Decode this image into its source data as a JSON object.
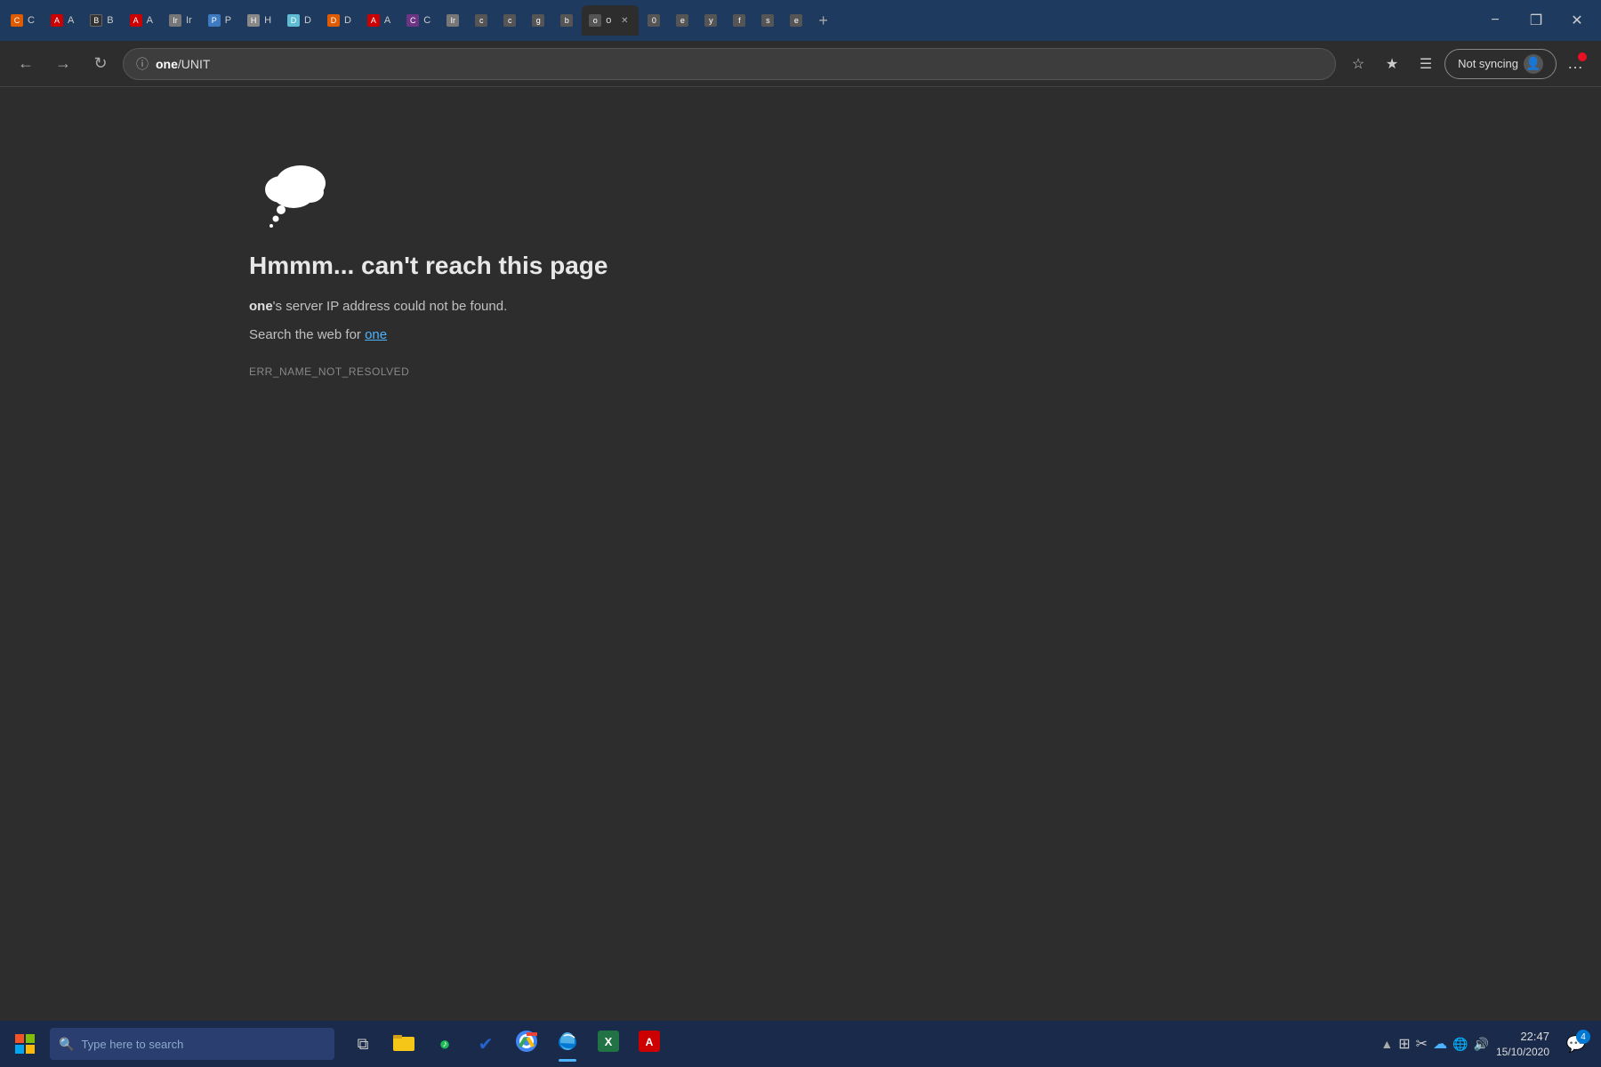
{
  "browser": {
    "title": "Microsoft Edge",
    "colors": {
      "tabbar_bg": "#1e3a5f",
      "toolbar_bg": "#2d2d2d",
      "content_bg": "#2d2d2d",
      "accent": "#0078d4"
    }
  },
  "tabs": [
    {
      "id": 1,
      "label": "C",
      "color": "#e05a00",
      "active": false
    },
    {
      "id": 2,
      "label": "A",
      "color": "#cc0000",
      "active": false
    },
    {
      "id": 3,
      "label": "B",
      "color": "#222",
      "active": false
    },
    {
      "id": 4,
      "label": "A",
      "color": "#cc0000",
      "active": false
    },
    {
      "id": 5,
      "label": "Ir",
      "color": "#555",
      "active": false
    },
    {
      "id": 6,
      "label": "P",
      "color": "#3e7abf",
      "active": false
    },
    {
      "id": 7,
      "label": "H",
      "color": "#555",
      "active": false
    },
    {
      "id": 8,
      "label": "D",
      "color": "#5dbcd2",
      "active": false
    },
    {
      "id": 9,
      "label": "D",
      "color": "#e05a00",
      "active": false
    },
    {
      "id": 10,
      "label": "A",
      "color": "#cc0000",
      "active": false
    },
    {
      "id": 11,
      "label": "C",
      "color": "#6c3483",
      "active": false
    },
    {
      "id": 12,
      "label": "Ir",
      "color": "#555",
      "active": false
    },
    {
      "id": 13,
      "label": "c",
      "color": "#555",
      "active": false
    },
    {
      "id": 14,
      "label": "c",
      "color": "#555",
      "active": false
    },
    {
      "id": 15,
      "label": "g",
      "color": "#555",
      "active": false
    },
    {
      "id": 16,
      "label": "b",
      "color": "#555",
      "active": false
    },
    {
      "id": 17,
      "label": "o",
      "color": "#555",
      "active": true,
      "closeable": true
    },
    {
      "id": 18,
      "label": "0",
      "color": "#555",
      "active": false
    },
    {
      "id": 19,
      "label": "e",
      "color": "#555",
      "active": false
    },
    {
      "id": 20,
      "label": "y",
      "color": "#555",
      "active": false
    },
    {
      "id": 21,
      "label": "f",
      "color": "#555",
      "active": false
    },
    {
      "id": 22,
      "label": "s",
      "color": "#555",
      "active": false
    },
    {
      "id": 23,
      "label": "e",
      "color": "#555",
      "active": false
    }
  ],
  "toolbar": {
    "url_display": "one/UNIT",
    "url_bold_part": "one",
    "url_plain_part": "/UNIT",
    "sync_label": "Not syncing",
    "back_disabled": false,
    "forward_disabled": false
  },
  "error_page": {
    "heading": "Hmmm... can't reach this page",
    "body_prefix": "'s server IP address could not be found.",
    "body_bold": "one",
    "search_text": "Search the web for ",
    "search_link": "one",
    "error_code": "ERR_NAME_NOT_RESOLVED"
  },
  "taskbar": {
    "search_placeholder": "Type here to search",
    "time": "22:47",
    "date": "15/10/2020",
    "notification_count": "4",
    "apps": [
      {
        "name": "cortana-search",
        "icon": "🔍",
        "active": false
      },
      {
        "name": "task-view",
        "icon": "⧉",
        "active": false
      },
      {
        "name": "file-explorer",
        "icon": "📁",
        "color": "#f5c518",
        "active": false
      },
      {
        "name": "spotify",
        "icon": "♫",
        "color": "#1db954",
        "active": false
      },
      {
        "name": "microsoft-to-do",
        "icon": "✔",
        "color": "#2564cf",
        "active": false
      },
      {
        "name": "chrome",
        "icon": "◎",
        "color": "#4285f4",
        "active": false
      },
      {
        "name": "edge",
        "icon": "e",
        "color": "#0078d4",
        "active": true
      },
      {
        "name": "excel",
        "icon": "X",
        "color": "#217346",
        "active": false
      },
      {
        "name": "acrobat",
        "icon": "A",
        "color": "#cc0000",
        "active": false
      }
    ]
  }
}
